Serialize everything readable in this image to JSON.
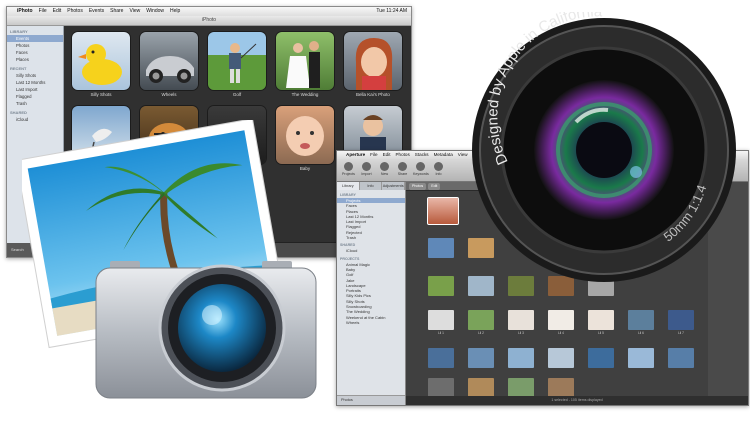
{
  "iphoto": {
    "menu": [
      "iPhoto",
      "File",
      "Edit",
      "Photos",
      "Events",
      "Share",
      "View",
      "Window",
      "Help"
    ],
    "clock": "Tue 11:24 AM",
    "window_title": "iPhoto",
    "sidebar": {
      "sections": [
        {
          "title": "LIBRARY",
          "items": [
            "Events",
            "Photos",
            "Faces",
            "Places"
          ]
        },
        {
          "title": "RECENT",
          "items": [
            "Silly Shots",
            "Last 12 Months",
            "Last Import",
            "Flagged",
            "Trash"
          ]
        },
        {
          "title": "SHARED",
          "items": [
            "iCloud"
          ]
        }
      ],
      "selected": "Events",
      "bottom_label": "Search"
    },
    "photos": [
      {
        "caption": "Silly Shots",
        "icon": "duck-photo"
      },
      {
        "caption": "Wheels",
        "icon": "car-photo"
      },
      {
        "caption": "Golf",
        "icon": "golf-photo"
      },
      {
        "caption": "The Wedding",
        "icon": "wedding-photo"
      },
      {
        "caption": "Bella Kai's Photo",
        "icon": "girl-photo"
      },
      {
        "caption": "",
        "icon": "bird-photo"
      },
      {
        "caption": "",
        "icon": "tiger-photo"
      },
      {
        "caption": "",
        "icon": "dark-photo"
      },
      {
        "caption": "Baby",
        "icon": "baby-photo"
      },
      {
        "caption": "",
        "icon": "boy-photo"
      }
    ]
  },
  "aperture": {
    "menu": [
      "Aperture",
      "File",
      "Edit",
      "Photos",
      "Stacks",
      "Metadata",
      "View",
      "Window"
    ],
    "toolbar": [
      "Projects",
      "Import",
      "New",
      "Share",
      "Keywords",
      "Info"
    ],
    "tabs": [
      "Library",
      "Info",
      "Adjustments"
    ],
    "sidebar": {
      "sections": [
        {
          "title": "LIBRARY",
          "items": [
            "Projects",
            "Faces",
            "Places",
            "Last 12 Months",
            "Last Import",
            "Flagged",
            "Rejected",
            "Trash"
          ]
        },
        {
          "title": "SHARED",
          "items": [
            "iCloud"
          ]
        },
        {
          "title": "PROJECTS",
          "items": [
            "Animal Magic",
            "Baby",
            "Golf",
            "Jake",
            "Landscape",
            "Portraits",
            "Silly Kids Pics",
            "Silly Shots",
            "Snowboarding",
            "The Wedding",
            "Weekend at the Cabin",
            "Wheels"
          ]
        }
      ],
      "selected": "Projects",
      "foot_label": "Photos"
    },
    "viewbar": [
      "Photos",
      "Edit"
    ],
    "status": "1 selected - 105 items displayed",
    "thumb_captions": [
      "Lil 1",
      "Lil 2",
      "Lil 3",
      "Lil 4",
      "Lil 5",
      "Lil 6",
      "Lil 7",
      "Lil 8"
    ]
  },
  "lens": {
    "ring_text": "Designed by Apple in California",
    "spec_text": "50mm 1:1.4"
  }
}
